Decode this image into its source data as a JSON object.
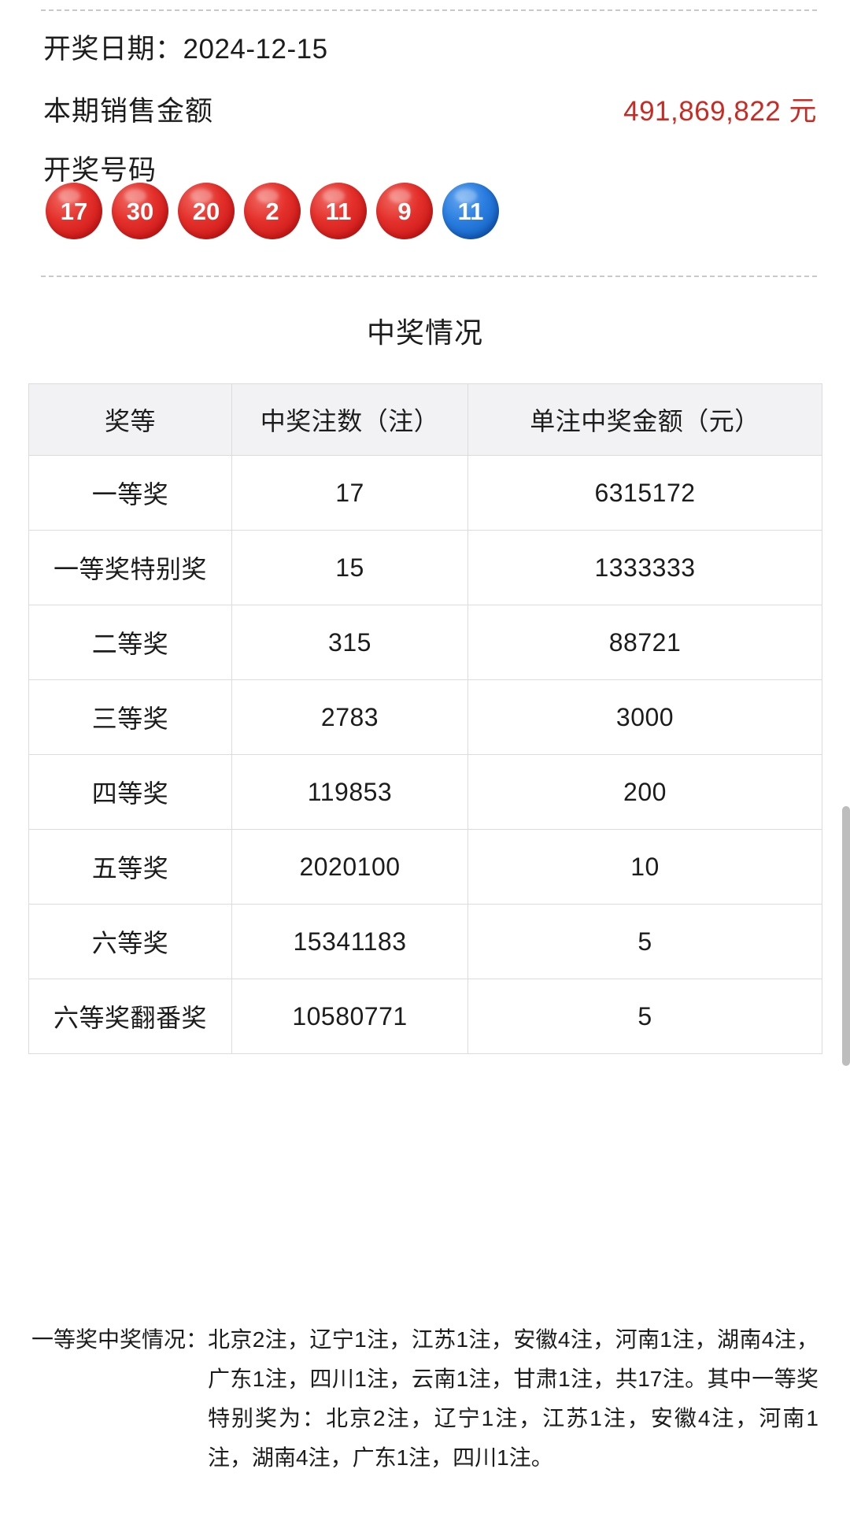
{
  "header": {
    "draw_date_label": "开奖日期：",
    "draw_date_value": "2024-12-15",
    "sales_label": "本期销售金额",
    "sales_value": "491,869,822 元",
    "numbers_label": "开奖号码"
  },
  "balls": {
    "red": [
      "17",
      "30",
      "20",
      "2",
      "11",
      "9"
    ],
    "blue": [
      "11"
    ],
    "red_color": "#e4302b",
    "blue_color": "#2b7ee0"
  },
  "section": {
    "title": "中奖情况"
  },
  "table": {
    "columns": [
      "奖等",
      "中奖注数（注）",
      "单注中奖金额（元）"
    ],
    "rows": [
      {
        "level": "一等奖",
        "count": "17",
        "amount": "6315172"
      },
      {
        "level": "一等奖特别奖",
        "count": "15",
        "amount": "1333333"
      },
      {
        "level": "二等奖",
        "count": "315",
        "amount": "88721"
      },
      {
        "level": "三等奖",
        "count": "2783",
        "amount": "3000"
      },
      {
        "level": "四等奖",
        "count": "119853",
        "amount": "200"
      },
      {
        "level": "五等奖",
        "count": "2020100",
        "amount": "10"
      },
      {
        "level": "六等奖",
        "count": "15341183",
        "amount": "5"
      },
      {
        "level": "六等奖翻番奖",
        "count": "10580771",
        "amount": "5"
      }
    ]
  },
  "note": {
    "label": "一等奖中奖情况：",
    "body": "北京2注，辽宁1注，江苏1注，安徽4注，河南1注，湖南4注，广东1注，四川1注，云南1注，甘肃1注，共17注。其中一等奖特别奖为：北京2注，辽宁1注，江苏1注，安徽4注，河南1注，湖南4注，广东1注，四川1注。"
  },
  "accent": {
    "red_text": "#c72b23"
  }
}
